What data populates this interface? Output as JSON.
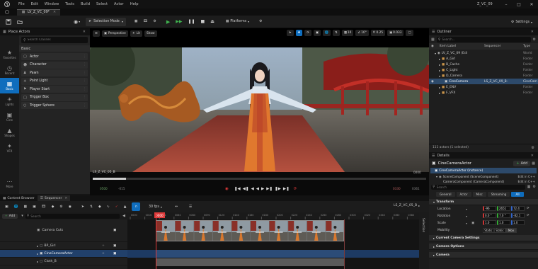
{
  "app": {
    "menu": [
      "File",
      "Edit",
      "Window",
      "Tools",
      "Build",
      "Select",
      "Actor",
      "Help"
    ],
    "project_name": "Z_VC_09",
    "level_tab": "LV_Z_VC_09*"
  },
  "toolbar": {
    "save_label": "Save",
    "selection_mode": "Selection Mode",
    "platforms": "Platforms",
    "settings": "Settings"
  },
  "place_actors": {
    "title": "Place Actors",
    "search_placeholder": "Search Classes",
    "section": "Basic",
    "items": [
      {
        "label": "Actor",
        "icon": "cube-outline-icon"
      },
      {
        "label": "Character",
        "icon": "person-icon"
      },
      {
        "label": "Pawn",
        "icon": "pawn-icon"
      },
      {
        "label": "Point Light",
        "icon": "bulb-icon"
      },
      {
        "label": "Player Start",
        "icon": "flag-icon"
      },
      {
        "label": "Trigger Box",
        "icon": "box-icon"
      },
      {
        "label": "Trigger Sphere",
        "icon": "sphere-icon"
      }
    ],
    "modes": [
      {
        "label": "Favorites",
        "icon": "star-icon"
      },
      {
        "label": "Recent",
        "icon": "clock-icon"
      },
      {
        "label": "Basic",
        "icon": "cube-icon",
        "selected": true
      },
      {
        "label": "Lights",
        "icon": "bulb-icon"
      },
      {
        "label": "Cine",
        "icon": "camera-icon"
      },
      {
        "label": "Shapes",
        "icon": "shapes-icon"
      },
      {
        "label": "VFX",
        "icon": "sparkle-icon"
      }
    ],
    "more": "More"
  },
  "viewport": {
    "perspective": "Perspective",
    "lit": "Lit",
    "show": "Show",
    "grid_snap": "10",
    "rot_snap": "10°",
    "scale_snap": "0.25",
    "cam_speed": "0.033",
    "shot_name": "LS_Z_VC_05_B",
    "frame_right": "0000",
    "frame_left_1": "0500",
    "frame_left_2": "-015",
    "frame_right_1": "0330",
    "frame_right_2": "0361"
  },
  "outliner": {
    "title": "Outliner",
    "search_placeholder": "Search...",
    "columns": [
      "Item Label",
      "Sequencer",
      "Type"
    ],
    "rows": [
      {
        "label": "LV_Z_VC_09 (Edi",
        "type": "World",
        "depth": 0,
        "kind": "world"
      },
      {
        "label": "A_Girl",
        "type": "Folder",
        "depth": 1,
        "kind": "folder"
      },
      {
        "label": "B_Cache",
        "type": "Folder",
        "depth": 1,
        "kind": "folder"
      },
      {
        "label": "C_Light",
        "type": "Folder",
        "depth": 1,
        "kind": "folder"
      },
      {
        "label": "D_Camera",
        "type": "Folder",
        "depth": 1,
        "kind": "folder"
      },
      {
        "label": "CineCamera",
        "sequencer": "LS_Z_VC_09_B-",
        "type": "CineCam",
        "depth": 2,
        "kind": "camera",
        "selected": true
      },
      {
        "label": "E_ENV",
        "type": "Folder",
        "depth": 1,
        "kind": "folder"
      },
      {
        "label": "F_VFX",
        "type": "Folder",
        "depth": 1,
        "kind": "folder"
      }
    ],
    "footer": "111 actors (1 selected)"
  },
  "details": {
    "title": "Details",
    "actor_name": "CineCameraActor",
    "add_label": "Add",
    "instance_label": "CineCameraActor (Instance)",
    "component_1": "SceneComponent (SceneComponent)",
    "component_1_edit": "Edit in C++",
    "component_2": "CameraComponent (CameraComponent)",
    "component_2_edit": "Edit in C++",
    "search_placeholder": "Search",
    "tabs": [
      "General",
      "Actor",
      "Misc",
      "Streaming",
      "All"
    ],
    "section_transform": "Transform",
    "location_label": "Location",
    "rotation_label": "Rotation",
    "scale_label": "Scale",
    "location": [
      "-96",
      "2651",
      "72.4"
    ],
    "rotation": [
      "0.0 °",
      "7.0 °",
      "-82.1"
    ],
    "scale": [
      "1.0",
      "1.0",
      "1.0"
    ],
    "mobility_label": "Mobility",
    "mobility": [
      "Static",
      "Static",
      "Mov"
    ],
    "sections": [
      "Current Camera Settings",
      "Camera Options",
      "Camera"
    ]
  },
  "bottom_tabs": {
    "content_browser": "Content Browser",
    "sequencer": "Sequencer"
  },
  "sequencer": {
    "add_label": "Add",
    "search_placeholder": "Search",
    "fps": "30 fps",
    "sequence_name": "LS_Z_VC_05_B",
    "current_frame": "0000",
    "selection_label": "Selection",
    "tracks": [
      {
        "label": "Camera Cuts",
        "indent": 0
      },
      {
        "label": "BP_Girl",
        "indent": 1
      },
      {
        "label": "CineCameraActor",
        "indent": 1,
        "selected": true
      },
      {
        "label": "Cloth_B",
        "indent": 1
      }
    ],
    "tick_labels": [
      "0000",
      "0016",
      "0041",
      "0064",
      "0080",
      "0090",
      "0120",
      "0140",
      "0160",
      "0180",
      "0200",
      "0220",
      "0240",
      "0260",
      "0280",
      "0300",
      "0320",
      "0340",
      "0360",
      "0380"
    ]
  },
  "colors": {
    "accent": "#0f6dbd",
    "play_green": "#3fb34f",
    "folder": "#c9944a",
    "playhead": "#e03a3a"
  }
}
